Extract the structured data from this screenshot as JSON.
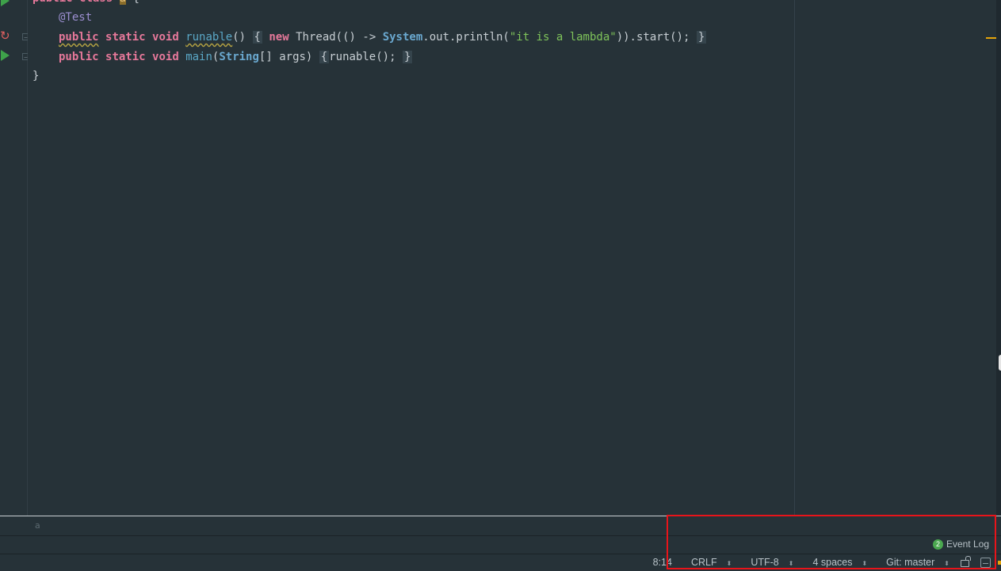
{
  "editor": {
    "class_line": {
      "kw_public": "public",
      "kw_class": "class",
      "name": "a",
      "brace": "{"
    },
    "annotation": "@Test",
    "line_runable": {
      "kw_public": "public",
      "kw_static": "static",
      "kw_void": "void",
      "method": "runable",
      "parens": "()",
      "body_open": "{",
      "kw_new": "new",
      "thread": "Thread(() -> ",
      "system": "System",
      "call": ".out.println(",
      "string": "\"it is a lambda\"",
      "tail": ")).start();",
      "body_close": "}"
    },
    "line_main": {
      "kw_public": "public",
      "kw_static": "static",
      "kw_void": "void",
      "method": "main",
      "open_paren": "(",
      "type": "String",
      "params": "[] args)",
      "body_open": "{",
      "call": "runable();",
      "body_close": "}"
    },
    "closing_brace": "}"
  },
  "bottom_panel": {
    "label": "a"
  },
  "event_log": {
    "count": "2",
    "label": "Event Log"
  },
  "status_bar": {
    "position": "8:14",
    "line_separator": "CRLF",
    "encoding": "UTF-8",
    "indent": "4 spaces",
    "vcs": "Git: master",
    "arrows": "⬍"
  },
  "colors": {
    "background": "#263238",
    "keyword": "#e6789a",
    "string": "#7fc45a",
    "highlight_box": "#e8141a"
  }
}
